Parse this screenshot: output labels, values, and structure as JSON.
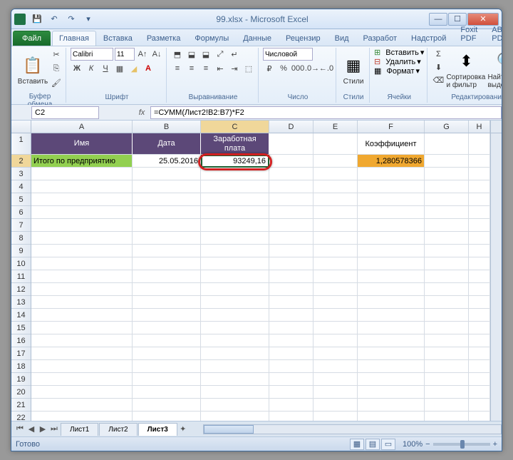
{
  "title": "99.xlsx - Microsoft Excel",
  "tabs": {
    "file": "Файл",
    "t": [
      "Главная",
      "Вставка",
      "Разметка",
      "Формулы",
      "Данные",
      "Рецензир",
      "Вид",
      "Разработ",
      "Надстрой",
      "Foxit PDF",
      "ABBYY PDF"
    ]
  },
  "groups": {
    "clipboard": "Буфер обмена",
    "font": "Шрифт",
    "align": "Выравнивание",
    "number": "Число",
    "styles": "Стили",
    "cells": "Ячейки",
    "editing": "Редактирование"
  },
  "buttons": {
    "paste": "Вставить",
    "styles": "Стили",
    "insert": "Вставить",
    "delete": "Удалить",
    "format": "Формат",
    "sort": "Сортировка и фильтр",
    "find": "Найти и выделить"
  },
  "font": {
    "name": "Calibri",
    "size": "11"
  },
  "number_format": "Числовой",
  "name_box": "C2",
  "formula": "=СУММ(Лист2!B2:B7)*F2",
  "headers": {
    "A": "Имя",
    "B": "Дата",
    "C": "Заработная плата",
    "F": "Коэффициент"
  },
  "row2": {
    "A": "Итого по предприятию",
    "B": "25.05.2016",
    "C": "93249,16",
    "F": "1,280578366"
  },
  "sheets": [
    "Лист1",
    "Лист2",
    "Лист3"
  ],
  "status": "Готово",
  "zoom": "100%",
  "cols": [
    "A",
    "B",
    "C",
    "D",
    "E",
    "F",
    "G",
    "H"
  ]
}
